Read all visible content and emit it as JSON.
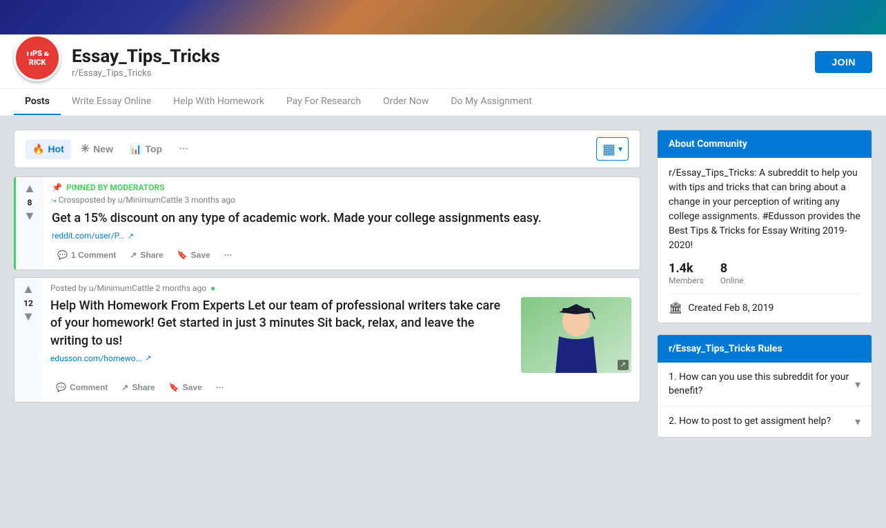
{
  "banner": {},
  "header": {
    "title": "Essay_Tips_Tricks",
    "subreddit": "r/Essay_Tips_Tricks",
    "join_label": "JOIN",
    "logo_line1": "TIPS &",
    "logo_line2": "TRICKS"
  },
  "nav": {
    "tabs": [
      {
        "label": "Posts",
        "active": true
      },
      {
        "label": "Write Essay Online",
        "active": false
      },
      {
        "label": "Help With Homework",
        "active": false
      },
      {
        "label": "Pay For Research",
        "active": false
      },
      {
        "label": "Order Now",
        "active": false
      },
      {
        "label": "Do My Assignment",
        "active": false
      }
    ]
  },
  "sort": {
    "hot_label": "Hot",
    "new_label": "New",
    "top_label": "Top",
    "more_label": "···"
  },
  "posts": [
    {
      "id": 1,
      "pinned": true,
      "pinned_label": "PINNED BY MODERATORS",
      "crosspost": "Crossposted by u/MinimumCattle 3 months ago",
      "vote_count": "8",
      "title": "Get a 15% discount on any type of academic work. Made your college assignments easy.",
      "link_text": "reddit.com/user/P...",
      "actions": [
        {
          "label": "1 Comment",
          "icon": "comment"
        },
        {
          "label": "Share",
          "icon": "share"
        },
        {
          "label": "Save",
          "icon": "save"
        },
        {
          "label": "···",
          "icon": "more"
        }
      ],
      "has_thumb": false
    },
    {
      "id": 2,
      "pinned": false,
      "poster": "Posted by u/MinimumCattle 2 months ago",
      "vote_count": "12",
      "title": "Help With Homework From Experts Let our team of professional writers take care of your homework! Get started in just 3 minutes Sit back, relax, and leave the writing to us!",
      "link_text": "edusson.com/homewo...",
      "actions": [
        {
          "label": "Comment",
          "icon": "comment"
        },
        {
          "label": "Share",
          "icon": "share"
        },
        {
          "label": "Save",
          "icon": "save"
        },
        {
          "label": "···",
          "icon": "more"
        }
      ],
      "has_thumb": true
    }
  ],
  "sidebar": {
    "about": {
      "header": "About Community",
      "description": "r/Essay_Tips_Tricks: A subreddit to help you with tips and tricks that can bring about a change in your perception of writing any college assignments. #Edusson provides the Best Tips & Tricks for Essay Writing 2019-2020!",
      "members_count": "1.4k",
      "members_label": "Members",
      "online_count": "8",
      "online_label": "Online",
      "created_label": "Created Feb 8, 2019"
    },
    "rules": {
      "header": "r/Essay_Tips_Tricks Rules",
      "items": [
        {
          "label": "1. How can you use this subreddit for your benefit?"
        },
        {
          "label": "2. How to post to get assigment help?"
        }
      ]
    }
  }
}
